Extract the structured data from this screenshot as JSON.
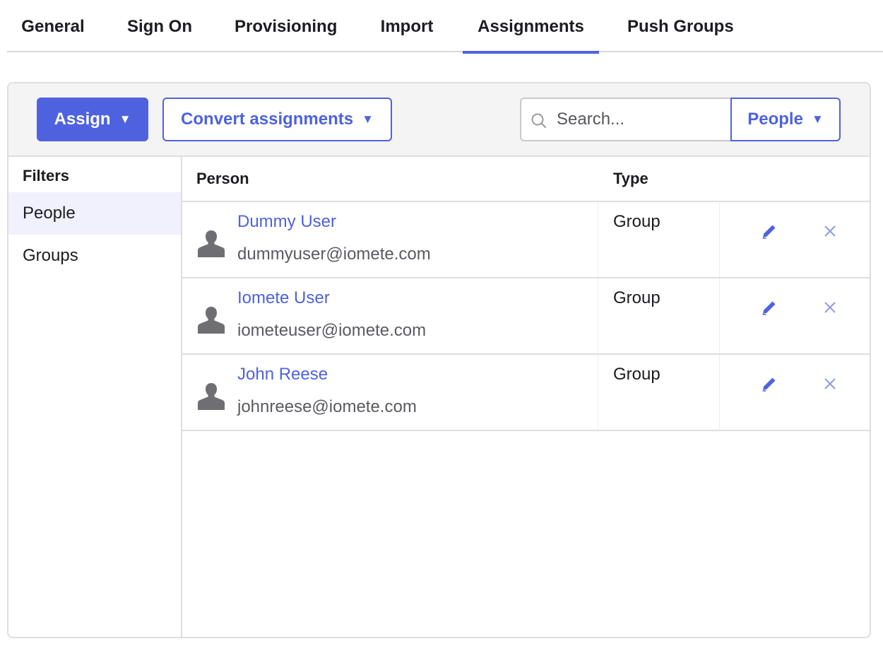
{
  "tabs": [
    {
      "label": "General"
    },
    {
      "label": "Sign On"
    },
    {
      "label": "Provisioning"
    },
    {
      "label": "Import"
    },
    {
      "label": "Assignments",
      "active": true
    },
    {
      "label": "Push Groups"
    }
  ],
  "toolbar": {
    "assign_label": "Assign",
    "convert_label": "Convert assignments",
    "search_placeholder": "Search...",
    "scope_label": "People",
    "dropdown_caret": "▼"
  },
  "filters": {
    "heading": "Filters",
    "items": [
      {
        "label": "People",
        "selected": true
      },
      {
        "label": "Groups",
        "selected": false
      }
    ]
  },
  "table": {
    "columns": [
      "Person",
      "Type"
    ],
    "rows": [
      {
        "name": "Dummy User",
        "email": "dummyuser@iomete.com",
        "type": "Group"
      },
      {
        "name": "Iomete User",
        "email": "iometeuser@iomete.com",
        "type": "Group"
      },
      {
        "name": "John Reese",
        "email": "johnreese@iomete.com",
        "type": "Group"
      }
    ]
  },
  "colors": {
    "accent": "#4e62e0",
    "border": "#dddde2",
    "toolbar_bg": "#f4f4f4",
    "selected_filter_bg": "#f1f1fd",
    "avatar": "#6e6e73",
    "remove_icon": "#8e9be8"
  },
  "icons": [
    "search-icon",
    "person-icon",
    "pencil-icon",
    "close-icon",
    "caret-down-icon"
  ]
}
